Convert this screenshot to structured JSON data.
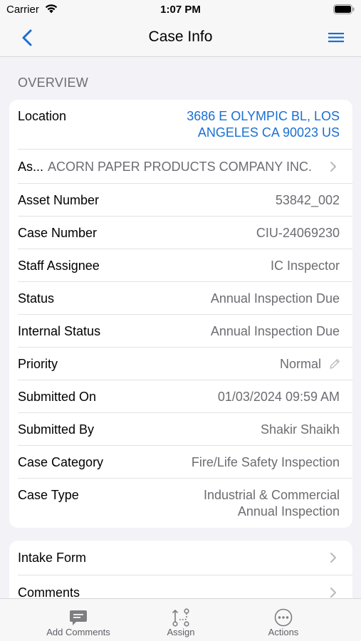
{
  "status_bar": {
    "carrier": "Carrier",
    "time": "1:07 PM"
  },
  "nav": {
    "title": "Case Info"
  },
  "overview": {
    "header": "OVERVIEW",
    "rows": [
      {
        "label": "Location",
        "value": "3686 E OLYMPIC BL, LOS",
        "value2": "ANGELES CA 90023 US"
      },
      {
        "label": "As...",
        "value": "ACORN PAPER PRODUCTS COMPANY INC."
      },
      {
        "label": "Asset Number",
        "value": "53842_002"
      },
      {
        "label": "Case Number",
        "value": "CIU-24069230"
      },
      {
        "label": "Staff Assignee",
        "value": "IC Inspector"
      },
      {
        "label": "Status",
        "value": "Annual Inspection Due"
      },
      {
        "label": "Internal Status",
        "value": "Annual Inspection Due"
      },
      {
        "label": "Priority",
        "value": "Normal"
      },
      {
        "label": "Submitted On",
        "value": "01/03/2024 09:59 AM"
      },
      {
        "label": "Submitted By",
        "value": "Shakir Shaikh"
      },
      {
        "label": "Case Category",
        "value": "Fire/Life Safety Inspection"
      },
      {
        "label": "Case Type",
        "value": "Industrial & Commercial",
        "value2": "Annual Inspection"
      }
    ]
  },
  "links": [
    {
      "label": "Intake Form"
    },
    {
      "label": "Comments"
    }
  ],
  "tabs": [
    {
      "label": "Add Comments",
      "icon": "comment-icon"
    },
    {
      "label": "Assign",
      "icon": "assign-icon"
    },
    {
      "label": "Actions",
      "icon": "more-icon"
    }
  ],
  "colors": {
    "link": "#1a6fd1",
    "accent": "#1a6fd1",
    "secondary_text": "#6d6d72"
  }
}
